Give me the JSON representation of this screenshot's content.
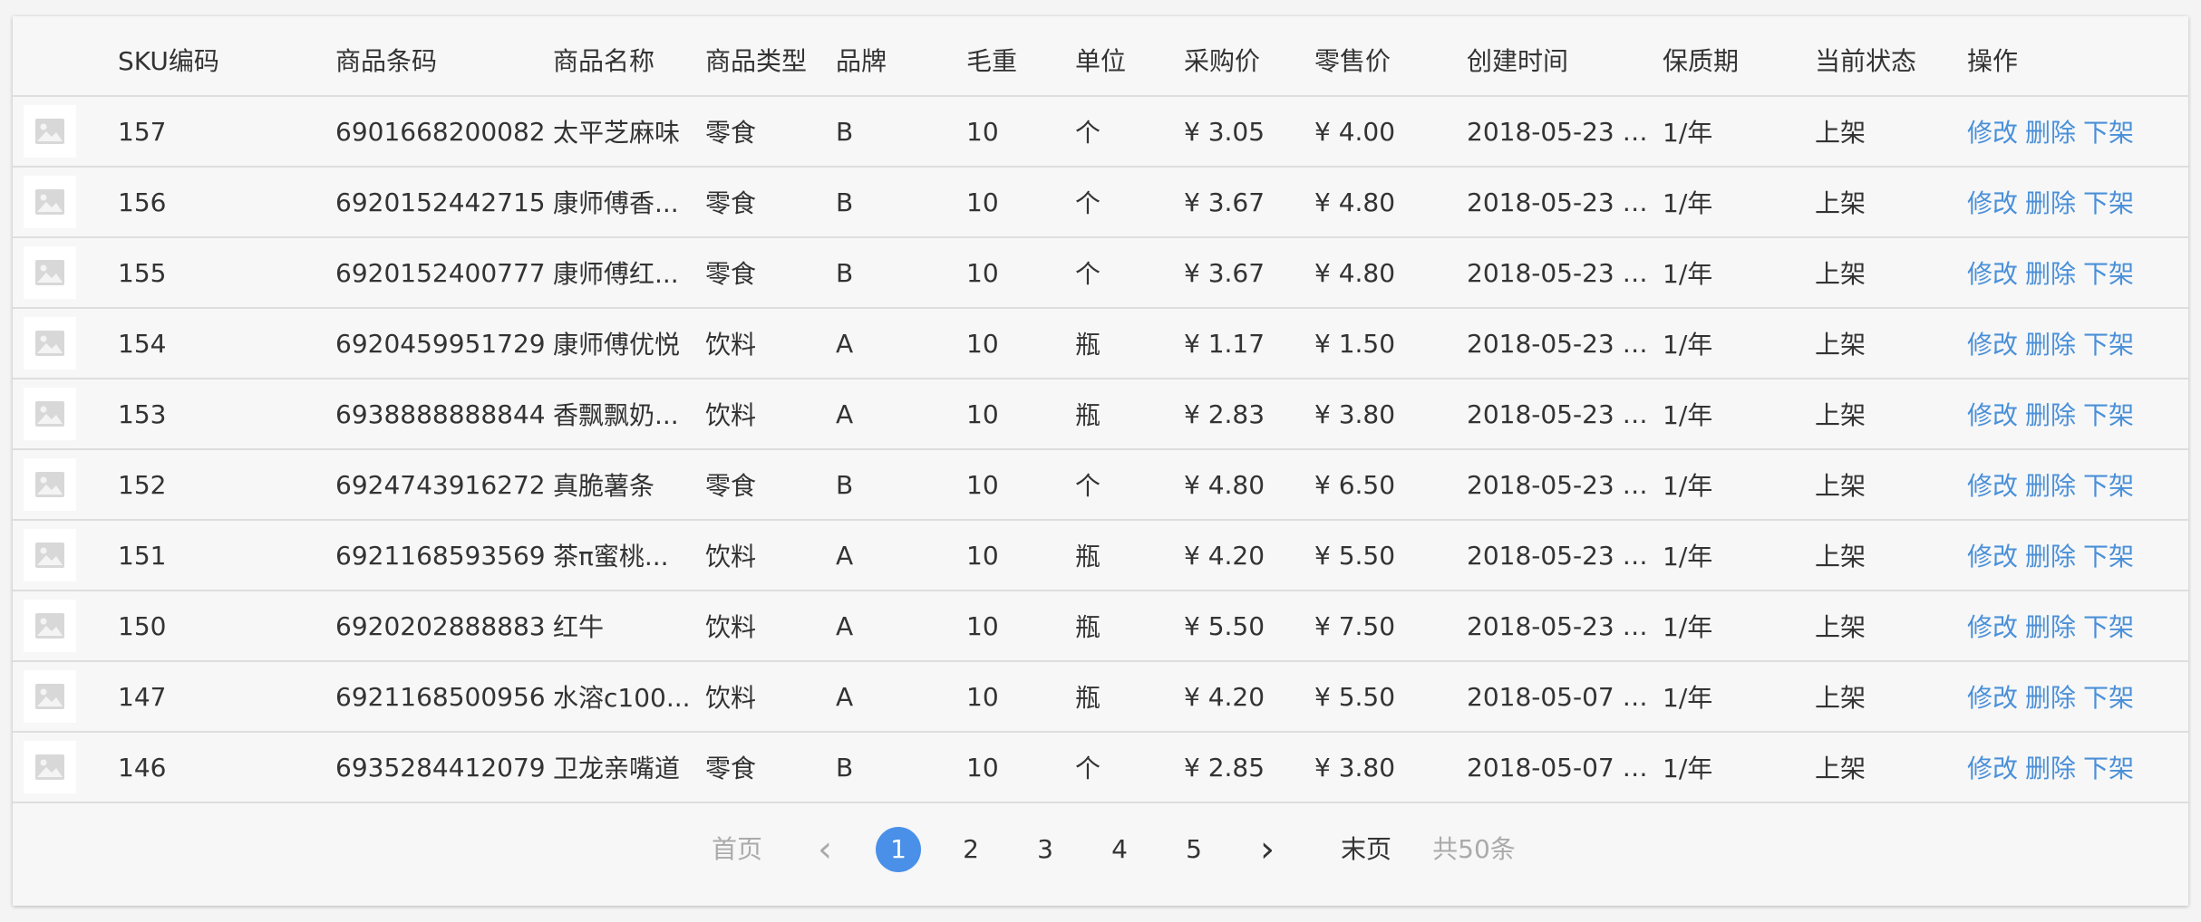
{
  "columns": [
    "",
    "SKU编码",
    "商品条码",
    "商品名称",
    "商品类型",
    "品牌",
    "毛重",
    "单位",
    "采购价",
    "零售价",
    "创建时间",
    "保质期",
    "当前状态",
    "操作"
  ],
  "actions": {
    "edit": "修改",
    "delete": "删除",
    "offshelf": "下架"
  },
  "rows": [
    {
      "sku": "157",
      "barcode": "6901668200082",
      "name": "太平芝麻味",
      "type": "零食",
      "brand": "B",
      "weight": "10",
      "unit": "个",
      "cost": "¥ 3.05",
      "price": "¥ 4.00",
      "created": "2018-05-23 0...",
      "shelf_life": "1/年",
      "status": "上架"
    },
    {
      "sku": "156",
      "barcode": "6920152442715",
      "name": "康师傅香...",
      "type": "零食",
      "brand": "B",
      "weight": "10",
      "unit": "个",
      "cost": "¥ 3.67",
      "price": "¥ 4.80",
      "created": "2018-05-23 0...",
      "shelf_life": "1/年",
      "status": "上架"
    },
    {
      "sku": "155",
      "barcode": "6920152400777",
      "name": "康师傅红...",
      "type": "零食",
      "brand": "B",
      "weight": "10",
      "unit": "个",
      "cost": "¥ 3.67",
      "price": "¥ 4.80",
      "created": "2018-05-23 0...",
      "shelf_life": "1/年",
      "status": "上架"
    },
    {
      "sku": "154",
      "barcode": "6920459951729",
      "name": "康师傅优悦",
      "type": "饮料",
      "brand": "A",
      "weight": "10",
      "unit": "瓶",
      "cost": "¥ 1.17",
      "price": "¥ 1.50",
      "created": "2018-05-23 0...",
      "shelf_life": "1/年",
      "status": "上架"
    },
    {
      "sku": "153",
      "barcode": "6938888888844",
      "name": "香飘飘奶...",
      "type": "饮料",
      "brand": "A",
      "weight": "10",
      "unit": "瓶",
      "cost": "¥ 2.83",
      "price": "¥ 3.80",
      "created": "2018-05-23 0...",
      "shelf_life": "1/年",
      "status": "上架"
    },
    {
      "sku": "152",
      "barcode": "6924743916272",
      "name": "真脆薯条",
      "type": "零食",
      "brand": "B",
      "weight": "10",
      "unit": "个",
      "cost": "¥ 4.80",
      "price": "¥ 6.50",
      "created": "2018-05-23 0...",
      "shelf_life": "1/年",
      "status": "上架"
    },
    {
      "sku": "151",
      "barcode": "6921168593569",
      "name": "茶π蜜桃...",
      "type": "饮料",
      "brand": "A",
      "weight": "10",
      "unit": "瓶",
      "cost": "¥ 4.20",
      "price": "¥ 5.50",
      "created": "2018-05-23 0...",
      "shelf_life": "1/年",
      "status": "上架"
    },
    {
      "sku": "150",
      "barcode": "6920202888883",
      "name": "红牛",
      "type": "饮料",
      "brand": "A",
      "weight": "10",
      "unit": "瓶",
      "cost": "¥ 5.50",
      "price": "¥ 7.50",
      "created": "2018-05-23 0...",
      "shelf_life": "1/年",
      "status": "上架"
    },
    {
      "sku": "147",
      "barcode": "6921168500956",
      "name": "水溶c100...",
      "type": "饮料",
      "brand": "A",
      "weight": "10",
      "unit": "瓶",
      "cost": "¥ 4.20",
      "price": "¥ 5.50",
      "created": "2018-05-07 1...",
      "shelf_life": "1/年",
      "status": "上架"
    },
    {
      "sku": "146",
      "barcode": "6935284412079",
      "name": "卫龙亲嘴道",
      "type": "零食",
      "brand": "B",
      "weight": "10",
      "unit": "个",
      "cost": "¥ 2.85",
      "price": "¥ 3.80",
      "created": "2018-05-07 1...",
      "shelf_life": "1/年",
      "status": "上架"
    }
  ],
  "pagination": {
    "first": "首页",
    "prev": "‹",
    "pages": [
      "1",
      "2",
      "3",
      "4",
      "5"
    ],
    "current": "1",
    "next": "›",
    "last": "末页",
    "total": "共50条"
  },
  "colors": {
    "link": "#4a90d9",
    "active_page": "#4a90e8",
    "disabled": "#aaaaaa"
  },
  "icons": {
    "thumbnail": "image-placeholder-icon",
    "prev": "chevron-left-icon",
    "next": "chevron-right-icon"
  }
}
